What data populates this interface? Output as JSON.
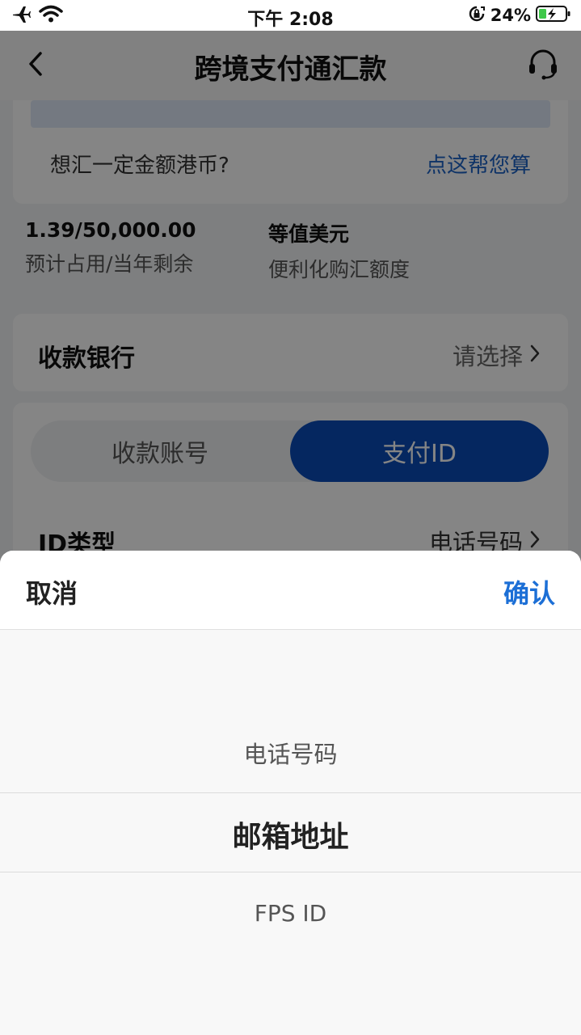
{
  "status_bar": {
    "time": "下午 2:08",
    "battery_percent": "24%",
    "icons": [
      "airplane-icon",
      "wifi-icon",
      "orientation-lock-icon",
      "battery-charging-icon"
    ]
  },
  "nav": {
    "title": "跨境支付通汇款",
    "back_icon": "chevron-left-icon",
    "service_icon": "headset-icon"
  },
  "calc": {
    "question": "想汇一定金额港币?",
    "link": "点这帮您算"
  },
  "quota": {
    "used_value": "1.39/50,000.00",
    "used_label": "预计占用/当年剩余",
    "equiv_value": "等值美元",
    "equiv_label": "便利化购汇额度"
  },
  "bank": {
    "label": "收款银行",
    "value": "请选择"
  },
  "account": {
    "tabs": [
      "收款账号",
      "支付ID"
    ],
    "active_tab": "支付ID",
    "id_type_label": "ID类型",
    "id_type_value": "电话号码"
  },
  "picker": {
    "cancel": "取消",
    "confirm": "确认",
    "options": [
      "电话号码",
      "邮箱地址",
      "FPS ID"
    ],
    "selected": "邮箱地址"
  },
  "colors": {
    "accent": "#0a4bb8",
    "link": "#1c63c6",
    "confirm": "#1c6fd6"
  }
}
